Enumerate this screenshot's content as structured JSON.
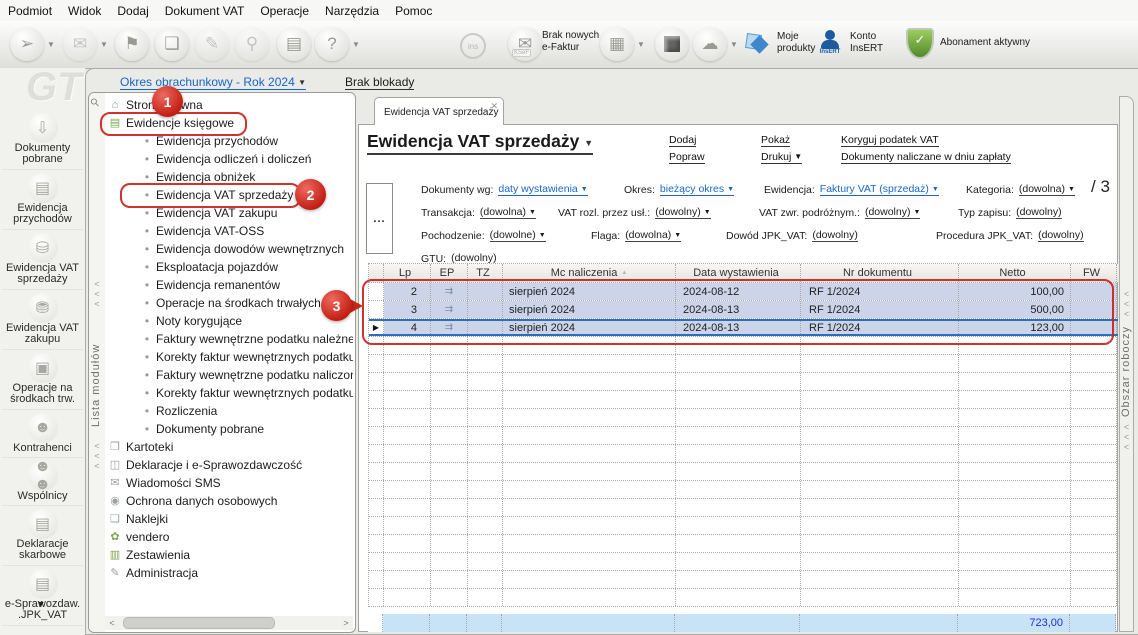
{
  "menu": {
    "items": [
      {
        "label": "Podmiot"
      },
      {
        "label": "Widok"
      },
      {
        "label": "Dodaj"
      },
      {
        "label": "Dokument VAT"
      },
      {
        "label": "Operacje"
      },
      {
        "label": "Narzędzia"
      },
      {
        "label": "Pomoc"
      }
    ]
  },
  "toolbar": {
    "efaktury_line1": "Brak nowych",
    "efaktury_line2": "e-Faktur",
    "moje_line1": "Moje",
    "moje_line2": "produkty",
    "konto_line1": "Konto",
    "konto_line2": "InsERT",
    "abonament": "Abonament aktywny",
    "ins_badge": "ins",
    "ksef_badge": "KSeF",
    "insert_logo": "InsERT"
  },
  "sidebar": {
    "items": [
      {
        "line1": "Dokumenty",
        "line2": "pobrane",
        "glyph": "⇩",
        "h": "two",
        "icon": "download-tray-icon"
      },
      {
        "line1": "Ewidencja",
        "line2": "przychodów",
        "glyph": "▤",
        "h": "two",
        "icon": "banknotes-icon"
      },
      {
        "line1": "Ewidencja VAT",
        "line2": "sprzedaży",
        "glyph": "⛁",
        "h": "two",
        "icon": "coins-icon"
      },
      {
        "line1": "Ewidencja VAT",
        "line2": "zakupu",
        "glyph": "⛃",
        "h": "two",
        "icon": "boxes-icon"
      },
      {
        "line1": "Operacje na",
        "line2": "środkach trw.",
        "glyph": "▣",
        "h": "two",
        "icon": "machines-icon"
      },
      {
        "line1": "Kontrahenci",
        "line2": "",
        "glyph": "☻",
        "h": "one",
        "icon": "person-icon"
      },
      {
        "line1": "Wspólnicy",
        "line2": "",
        "glyph": "☻☻",
        "h": "one",
        "icon": "people-icon"
      },
      {
        "line1": "Deklaracje",
        "line2": "skarbowe",
        "glyph": "▤",
        "h": "two",
        "icon": "newspaper-icon"
      },
      {
        "line1": "e-Sprawozdaw.",
        "line2": ".JPK_VAT",
        "glyph": "▤",
        "h": "two",
        "icon": "jpk-report-icon"
      }
    ],
    "more_arrow": "▼"
  },
  "tree": {
    "period_link": "Okres obrachunkowy - Rok 2024",
    "lock_link": "Brak blokady",
    "strip_label": "Lista modułów",
    "chevron": "<",
    "scroll_left": "<",
    "scroll_right": ">",
    "items": [
      {
        "label": "Strona główna",
        "cls": "lvl0",
        "glyph": "⌂",
        "iconcls": "ic-teal"
      },
      {
        "label": "Ewidencje księgowe",
        "cls": "lvl0",
        "glyph": "▤",
        "iconcls": "ic-green"
      },
      {
        "label": "Ewidencja przychodów",
        "cls": "lvl1",
        "glyph": "•"
      },
      {
        "label": "Ewidencja odliczeń i doliczeń",
        "cls": "lvl1",
        "glyph": "•"
      },
      {
        "label": "Ewidencja obniżek",
        "cls": "lvl1",
        "glyph": "•"
      },
      {
        "label": "Ewidencja VAT sprzedaży",
        "cls": "lvl1",
        "glyph": "•"
      },
      {
        "label": "Ewidencja VAT zakupu",
        "cls": "lvl1",
        "glyph": "•"
      },
      {
        "label": "Ewidencja VAT-OSS",
        "cls": "lvl1",
        "glyph": "•"
      },
      {
        "label": "Ewidencja dowodów wewnętrznych",
        "cls": "lvl1",
        "glyph": "•"
      },
      {
        "label": "Eksploatacja pojazdów",
        "cls": "lvl1",
        "glyph": "•"
      },
      {
        "label": "Ewidencja remanentów",
        "cls": "lvl1",
        "glyph": "•"
      },
      {
        "label": "Operacje na środkach trwałych",
        "cls": "lvl1",
        "glyph": "•"
      },
      {
        "label": "Noty korygujące",
        "cls": "lvl1",
        "glyph": "•"
      },
      {
        "label": "Faktury wewnętrzne podatku należnego",
        "cls": "lvl1",
        "glyph": "•"
      },
      {
        "label": "Korekty faktur wewnętrznych podatku",
        "cls": "lvl1",
        "glyph": "•"
      },
      {
        "label": "Faktury wewnętrzne podatku naliczonego",
        "cls": "lvl1",
        "glyph": "•"
      },
      {
        "label": "Korekty faktur wewnętrznych podatku",
        "cls": "lvl1",
        "glyph": "•"
      },
      {
        "label": "Rozliczenia",
        "cls": "lvl1",
        "glyph": "•"
      },
      {
        "label": "Dokumenty pobrane",
        "cls": "lvl1",
        "glyph": "•"
      },
      {
        "label": "Kartoteki",
        "cls": "lvl0",
        "glyph": "❒",
        "iconcls": "ic-gray"
      },
      {
        "label": "Deklaracje i e-Sprawozdawczość",
        "cls": "lvl0",
        "glyph": "◫",
        "iconcls": "ic-gray"
      },
      {
        "label": "Wiadomości SMS",
        "cls": "lvl0",
        "glyph": "✉",
        "iconcls": "ic-gray"
      },
      {
        "label": "Ochrona danych osobowych",
        "cls": "lvl0",
        "glyph": "◉",
        "iconcls": "ic-gray"
      },
      {
        "label": "Naklejki",
        "cls": "lvl0",
        "glyph": "❏",
        "iconcls": "ic-gray"
      },
      {
        "label": "vendero",
        "cls": "lvl0",
        "glyph": "✿",
        "iconcls": "ic-green"
      },
      {
        "label": "Zestawienia",
        "cls": "lvl0",
        "glyph": "▥",
        "iconcls": "ic-green"
      },
      {
        "label": "Administracja",
        "cls": "lvl0",
        "glyph": "✎",
        "iconcls": "ic-gray"
      }
    ]
  },
  "main": {
    "tab": "Ewidencja VAT sprzedaży",
    "close_icon": "✕",
    "title": "Ewidencja VAT sprzedaży",
    "actions": {
      "col1": [
        "Dodaj",
        "Popraw"
      ],
      "col2": [
        "Pokaż",
        "Drukuj"
      ],
      "col3": [
        "Koryguj podatek VAT",
        "Dokumenty naliczane w dniu zapłaty"
      ]
    },
    "more_button": "...",
    "count": "/ 3",
    "workspace_strip": "Obszar roboczy",
    "filters": {
      "row1": [
        {
          "label": "Dokumenty wg:",
          "value": "daty wystawienia",
          "cls": "blue arrow"
        },
        {
          "label": "Okres:",
          "value": "bieżący okres",
          "cls": "blue arrow"
        },
        {
          "label": "Ewidencja:",
          "value": "Faktury VAT (sprzedaż)",
          "cls": "blue arrow"
        },
        {
          "label": "Kategoria:",
          "value": "(dowolna)",
          "cls": "arrow"
        }
      ],
      "row2": [
        {
          "label": "Transakcja:",
          "value": "(dowolna)",
          "cls": "arrow"
        },
        {
          "label": "VAT rozl. przez usł.:",
          "value": "(dowolny)",
          "cls": "arrow"
        },
        {
          "label": "VAT zwr. podróżnym.:",
          "value": "(dowolny)",
          "cls": "arrow"
        },
        {
          "label": "Typ zapisu:",
          "value": "(dowolny)",
          "cls": ""
        }
      ],
      "row3": [
        {
          "label": "Pochodzenie:",
          "value": "(dowolne)",
          "cls": "arrow"
        },
        {
          "label": "Flaga:",
          "value": "(dowolna)",
          "cls": "arrow"
        },
        {
          "label": "Dowód JPK_VAT:",
          "value": "(dowolny)",
          "cls": ""
        },
        {
          "label": "Procedura JPK_VAT:",
          "value": "(dowolny)",
          "cls": ""
        }
      ],
      "row4": [
        {
          "label": "GTU:",
          "value": "(dowolny)",
          "cls": ""
        }
      ]
    },
    "table": {
      "headers": [
        {
          "label": "",
          "sort": ""
        },
        {
          "label": "Lp",
          "sort": ""
        },
        {
          "label": "EP",
          "sort": ""
        },
        {
          "label": "TZ",
          "sort": ""
        },
        {
          "label": "Mc naliczenia",
          "sort": "▲"
        },
        {
          "label": "Data wystawienia",
          "sort": ""
        },
        {
          "label": "Nr dokumentu",
          "sort": ""
        },
        {
          "label": "Netto",
          "sort": ""
        },
        {
          "label": "FW",
          "sort": ""
        }
      ],
      "rows": [
        {
          "marker": "",
          "lp": "2",
          "ep": "⇉",
          "mc": "sierpień 2024",
          "dw": "2024-08-12",
          "nr": "RF 1/2024",
          "netto": "100,00",
          "cls": ""
        },
        {
          "marker": "",
          "lp": "3",
          "ep": "⇉",
          "mc": "sierpień 2024",
          "dw": "2024-08-13",
          "nr": "RF 1/2024",
          "netto": "500,00",
          "cls": ""
        },
        {
          "marker": "▶",
          "lp": "4",
          "ep": "⇉",
          "mc": "sierpień 2024",
          "dw": "2024-08-13",
          "nr": "RF 1/2024",
          "netto": "123,00",
          "cls": "focused"
        }
      ],
      "empty_rows": [
        {},
        {},
        {},
        {},
        {},
        {},
        {},
        {},
        {},
        {},
        {},
        {},
        {},
        {},
        {}
      ],
      "summary_netto": "723,00"
    }
  },
  "annotations": {
    "c1": "1",
    "c2": "2",
    "c3": "3"
  }
}
